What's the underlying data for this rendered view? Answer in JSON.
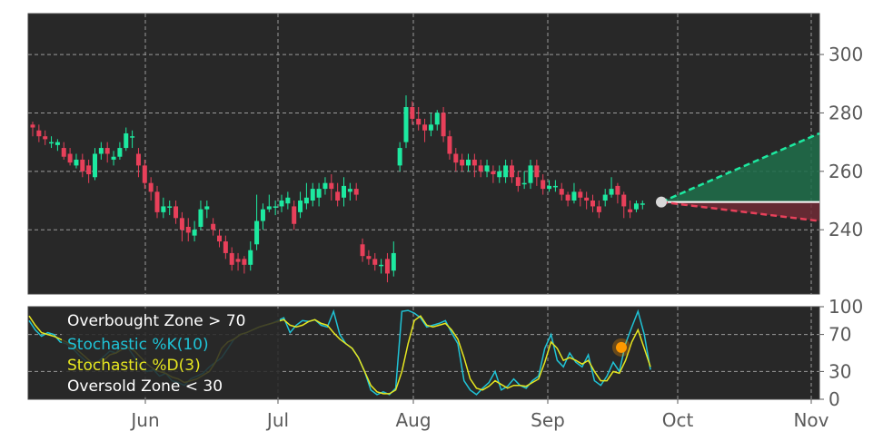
{
  "chart_data": [
    {
      "type": "candlestick",
      "x_tick_labels": [
        "Jun",
        "Jul",
        "Aug",
        "Sep",
        "Oct",
        "Nov"
      ],
      "y_ticks": [
        240,
        260,
        280,
        300
      ],
      "ylim": [
        218,
        314
      ],
      "background": "#282828",
      "up_color": "#1de9a0",
      "down_color": "#e8405a",
      "candles": [
        [
          276,
          275,
          277,
          272
        ],
        [
          274,
          272,
          276,
          270
        ],
        [
          272,
          271,
          274,
          269
        ],
        [
          270,
          270,
          272,
          268
        ],
        [
          269,
          270,
          271,
          267
        ],
        [
          268,
          265,
          270,
          264
        ],
        [
          266,
          263,
          268,
          262
        ],
        [
          262,
          264,
          266,
          261
        ],
        [
          264,
          260,
          266,
          258
        ],
        [
          262,
          259,
          264,
          256
        ],
        [
          258,
          266,
          268,
          257
        ],
        [
          266,
          268,
          270,
          264
        ],
        [
          268,
          266,
          270,
          263
        ],
        [
          264,
          265,
          267,
          262
        ],
        [
          265,
          268,
          270,
          264
        ],
        [
          268,
          273,
          275,
          267
        ],
        [
          272,
          272,
          274,
          268
        ],
        [
          266,
          262,
          268,
          258
        ],
        [
          262,
          256,
          264,
          254
        ],
        [
          256,
          253,
          258,
          250
        ],
        [
          253,
          246,
          255,
          244
        ],
        [
          246,
          248,
          251,
          244
        ],
        [
          248,
          248,
          250,
          245
        ],
        [
          248,
          244,
          250,
          242
        ],
        [
          244,
          240,
          246,
          236
        ],
        [
          241,
          239,
          244,
          236
        ],
        [
          238,
          240,
          243,
          236
        ],
        [
          241,
          247,
          250,
          240
        ],
        [
          247,
          248,
          250,
          244
        ],
        [
          242,
          240,
          244,
          238
        ],
        [
          238,
          236,
          240,
          234
        ],
        [
          236,
          232,
          238,
          230
        ],
        [
          232,
          228,
          234,
          226
        ],
        [
          230,
          229,
          232,
          226
        ],
        [
          230,
          228,
          231,
          225
        ],
        [
          228,
          233,
          236,
          226
        ],
        [
          235,
          243,
          252,
          233
        ],
        [
          243,
          247,
          249,
          240
        ],
        [
          247,
          248,
          252,
          246
        ],
        [
          248,
          248,
          250,
          245
        ],
        [
          248,
          250,
          252,
          246
        ],
        [
          249,
          251,
          253,
          247
        ],
        [
          248,
          242,
          250,
          240
        ],
        [
          246,
          250,
          253,
          244
        ],
        [
          249,
          251,
          256,
          247
        ],
        [
          250,
          254,
          256,
          248
        ],
        [
          251,
          254,
          256,
          248
        ],
        [
          254,
          256,
          258,
          252
        ],
        [
          256,
          254,
          259,
          250
        ],
        [
          253,
          250,
          256,
          248
        ],
        [
          251,
          255,
          258,
          248
        ],
        [
          253,
          254,
          256,
          250
        ],
        [
          254,
          252,
          256,
          250
        ],
        [
          235,
          231,
          237,
          229
        ],
        [
          231,
          230,
          233,
          228
        ],
        [
          230,
          228,
          232,
          226
        ],
        [
          228,
          228,
          230,
          225
        ],
        [
          230,
          225,
          232,
          222
        ],
        [
          226,
          232,
          236,
          224
        ],
        [
          262,
          268,
          270,
          260
        ],
        [
          270,
          282,
          286,
          268
        ],
        [
          282,
          278,
          284,
          276
        ],
        [
          278,
          276,
          282,
          274
        ],
        [
          276,
          274,
          278,
          270
        ],
        [
          274,
          276,
          280,
          272
        ],
        [
          276,
          280,
          281,
          274
        ],
        [
          280,
          272,
          282,
          270
        ],
        [
          272,
          266,
          274,
          264
        ],
        [
          266,
          263,
          268,
          260
        ],
        [
          264,
          262,
          266,
          260
        ],
        [
          262,
          264,
          266,
          260
        ],
        [
          264,
          262,
          266,
          258
        ],
        [
          262,
          260,
          264,
          258
        ],
        [
          260,
          262,
          264,
          258
        ],
        [
          260,
          259,
          262,
          256
        ],
        [
          258,
          260,
          262,
          256
        ],
        [
          258,
          262,
          264,
          256
        ],
        [
          262,
          258,
          264,
          256
        ],
        [
          258,
          255,
          260,
          253
        ],
        [
          256,
          256,
          260,
          254
        ],
        [
          256,
          262,
          264,
          254
        ],
        [
          262,
          258,
          264,
          255
        ],
        [
          257,
          254,
          259,
          252
        ],
        [
          254,
          255,
          257,
          253
        ],
        [
          255,
          255,
          257,
          253
        ],
        [
          254,
          252,
          256,
          250
        ],
        [
          252,
          250,
          253,
          248
        ],
        [
          250,
          253,
          256,
          249
        ],
        [
          253,
          251,
          254,
          248
        ],
        [
          251,
          250,
          253,
          247
        ],
        [
          250,
          248,
          252,
          246
        ],
        [
          248,
          246,
          250,
          244
        ],
        [
          250,
          252,
          254,
          248
        ],
        [
          252,
          254,
          258,
          251
        ],
        [
          255,
          252,
          256,
          249
        ],
        [
          252,
          248,
          253,
          244
        ],
        [
          247,
          246,
          250,
          244
        ],
        [
          247,
          249,
          250,
          246
        ],
        [
          249,
          249,
          250,
          247
        ]
      ],
      "last_price": 249.5,
      "projection_upper": 273,
      "projection_lower": 243
    },
    {
      "type": "line",
      "ylim": [
        0,
        100
      ],
      "y_ticks": [
        0,
        30,
        70,
        100
      ],
      "legend_placement": "top-left",
      "series": [
        {
          "name": "Stochastic %K(10)",
          "color": "#1fc3d6",
          "values": [
            85,
            75,
            68,
            72,
            70,
            62,
            60,
            55,
            48,
            42,
            35,
            40,
            46,
            52,
            50,
            60,
            55,
            45,
            35,
            30,
            32,
            25,
            28,
            20,
            18,
            15,
            22,
            25,
            28,
            35,
            40,
            45,
            55,
            65,
            70,
            72,
            75,
            78,
            80,
            82,
            85,
            88,
            72,
            80,
            85,
            84,
            86,
            80,
            78,
            95,
            70,
            60,
            55,
            45,
            30,
            10,
            5,
            8,
            5,
            12,
            95,
            96,
            93,
            88,
            78,
            80,
            82,
            85,
            72,
            60,
            20,
            10,
            5,
            12,
            18,
            30,
            10,
            14,
            22,
            15,
            12,
            20,
            25,
            55,
            70,
            42,
            35,
            50,
            40,
            35,
            48,
            20,
            15,
            25,
            40,
            30,
            60,
            78,
            95,
            70,
            32
          ]
        },
        {
          "name": "Stochastic %D(3)",
          "color": "#e6e620",
          "values": [
            90,
            80,
            72,
            70,
            68,
            65,
            62,
            58,
            52,
            46,
            40,
            40,
            42,
            48,
            50,
            54,
            56,
            52,
            45,
            38,
            33,
            30,
            28,
            24,
            22,
            18,
            20,
            22,
            26,
            30,
            40,
            55,
            62,
            65,
            70,
            72,
            75,
            78,
            80,
            82,
            84,
            86,
            80,
            78,
            80,
            84,
            86,
            82,
            80,
            72,
            65,
            60,
            55,
            45,
            30,
            15,
            8,
            6,
            6,
            10,
            30,
            60,
            85,
            90,
            80,
            78,
            80,
            82,
            75,
            65,
            45,
            22,
            12,
            10,
            14,
            20,
            16,
            12,
            15,
            15,
            14,
            18,
            22,
            40,
            62,
            55,
            42,
            45,
            42,
            38,
            42,
            30,
            20,
            20,
            30,
            28,
            42,
            62,
            75,
            55,
            35
          ]
        }
      ],
      "overbought_label": "Overbought Zone > 70",
      "oversold_label": "Oversold Zone < 30",
      "overbought_level": 70,
      "oversold_level": 30,
      "marker_value": 56,
      "marker_color": "#ff9900"
    }
  ]
}
